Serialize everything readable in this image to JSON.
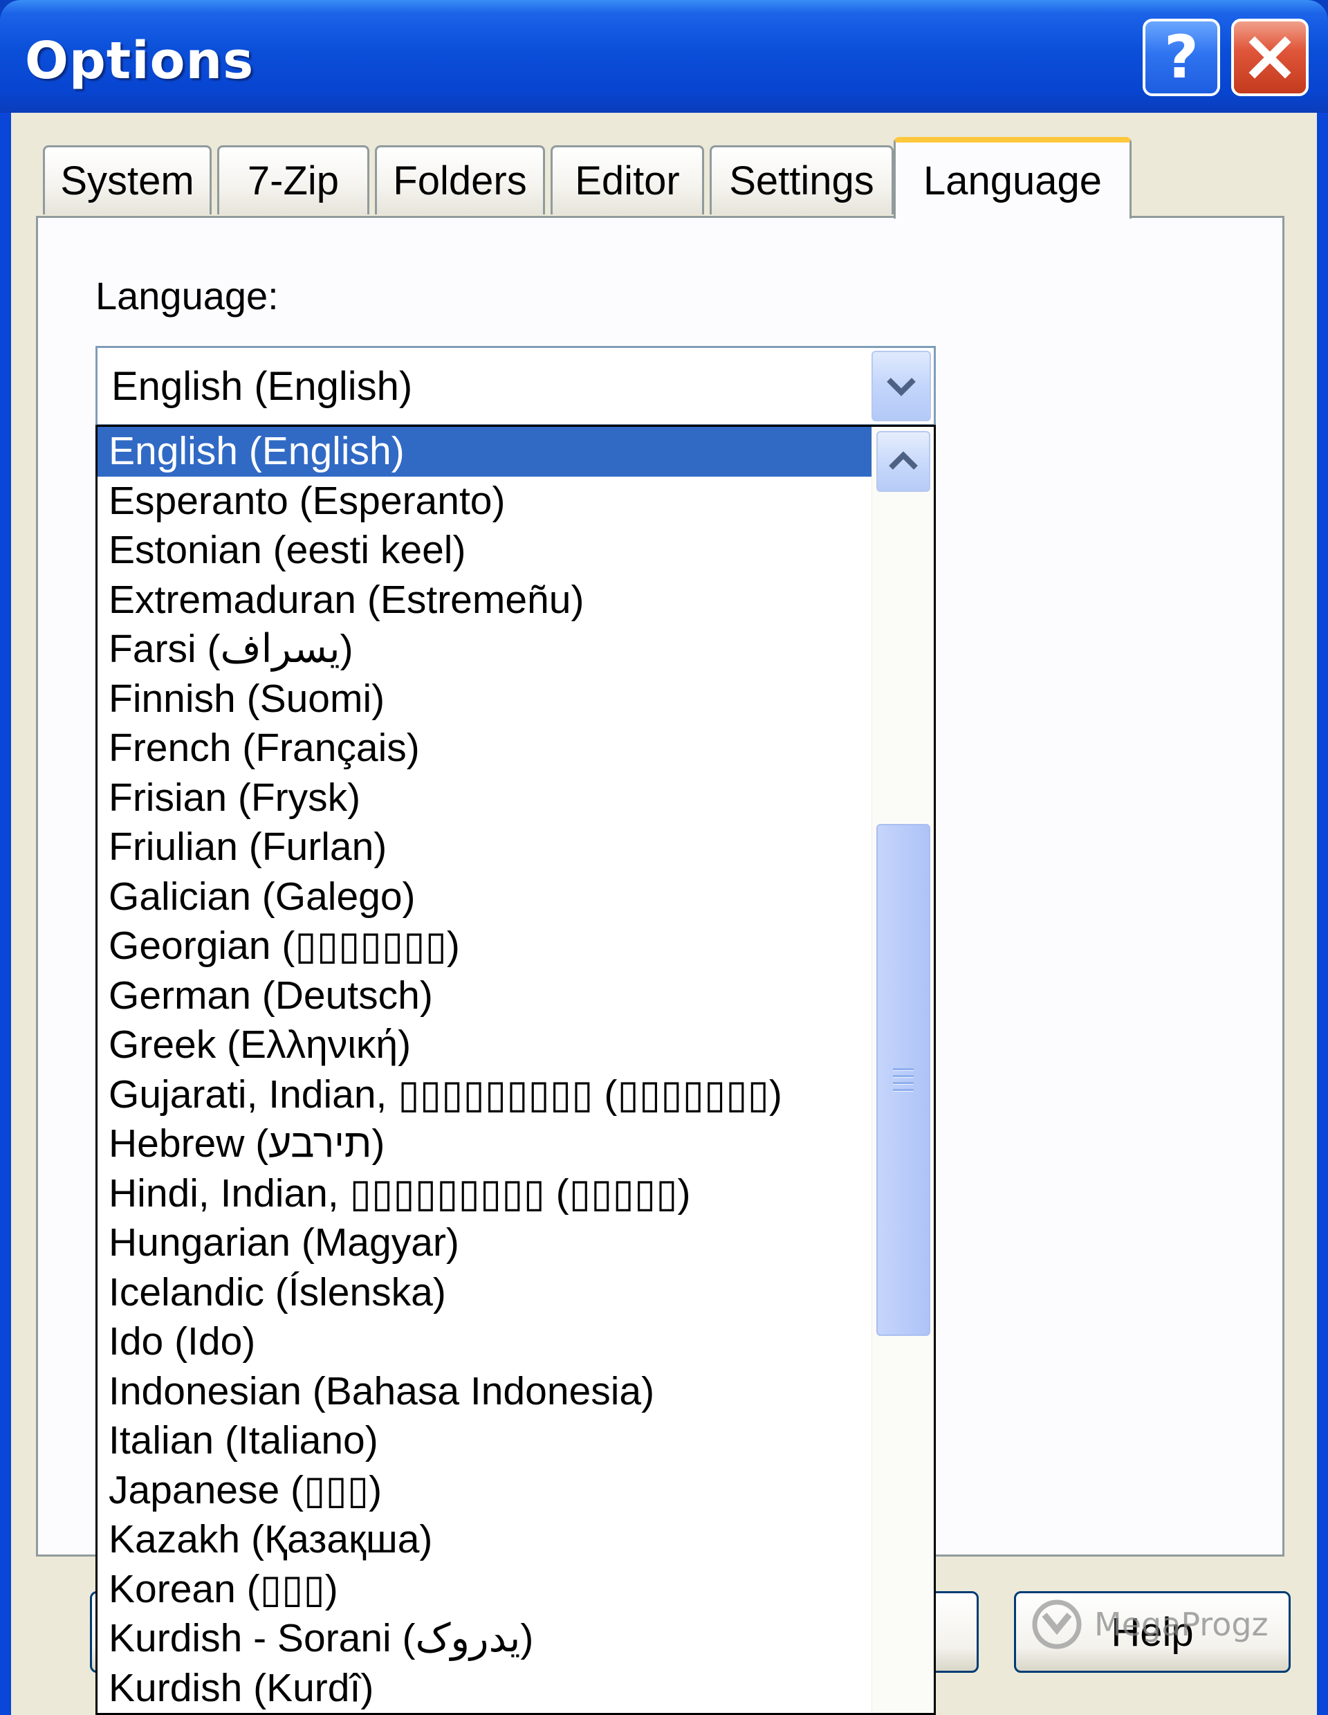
{
  "window": {
    "title": "Options",
    "help_symbol": "?"
  },
  "tabs": [
    {
      "label": "System"
    },
    {
      "label": "7-Zip"
    },
    {
      "label": "Folders"
    },
    {
      "label": "Editor"
    },
    {
      "label": "Settings"
    },
    {
      "label": "Language"
    }
  ],
  "language": {
    "label": "Language:",
    "selected": "English (English)",
    "options": [
      "English (English)",
      "Esperanto (Esperanto)",
      "Estonian (eesti keel)",
      "Extremaduran (Estremeñu)",
      "Farsi (یسراف)",
      "Finnish (Suomi)",
      "French (Français)",
      "Frisian (Frysk)",
      "Friulian (Furlan)",
      "Galician (Galego)",
      "Georgian (▯▯▯▯▯▯▯)",
      "German (Deutsch)",
      "Greek (Ελληνική)",
      "Gujarati, Indian, ▯▯▯▯▯▯▯▯▯ (▯▯▯▯▯▯▯)",
      "Hebrew (תירבע)",
      "Hindi, Indian, ▯▯▯▯▯▯▯▯▯ (▯▯▯▯▯)",
      "Hungarian (Magyar)",
      "Icelandic (Íslenska)",
      "Ido (Ido)",
      "Indonesian (Bahasa Indonesia)",
      "Italian (Italiano)",
      "Japanese (▯▯▯)",
      "Kazakh (Қазақша)",
      "Korean (▯▯▯)",
      "Kurdish - Sorani (یدروک)",
      "Kurdish (Kurdî)"
    ]
  },
  "buttons": {
    "help": "Help"
  },
  "watermark": "MegaProgz",
  "icons": {
    "close": "close-icon",
    "combo_arrow": "chevron-down-icon",
    "scroll_up": "chevron-up-icon",
    "thumb_grip": "grip-icon",
    "watermark_logo": "megaprogz-logo-icon"
  },
  "colors": {
    "title_bar": "#0b4fd9",
    "selection": "#316ac5",
    "active_tab_accent": "#ffc83c",
    "close_button": "#e0563a"
  }
}
